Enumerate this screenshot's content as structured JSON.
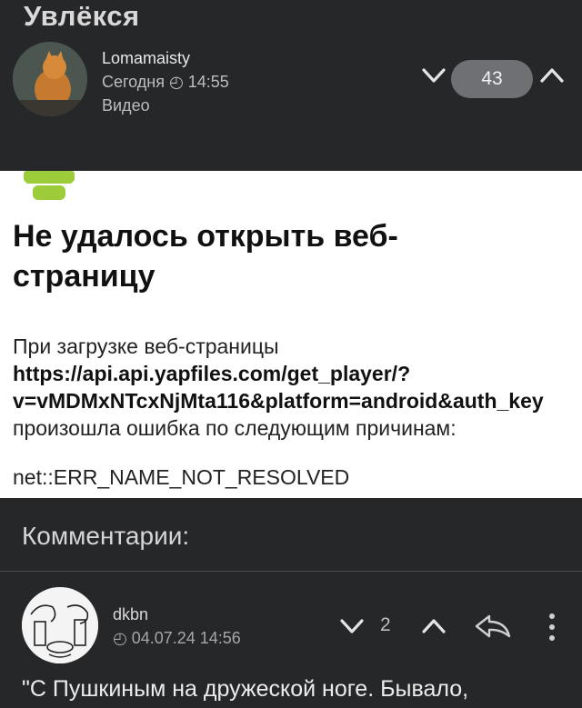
{
  "post": {
    "title": "Увлёкся",
    "author": "Lomamaisty",
    "date": "Сегодня ◴ 14:55",
    "type": "Видео",
    "rating": "43"
  },
  "webview_error": {
    "title": "Не удалось открыть веб-страницу",
    "line1": "При загрузке веб-страницы",
    "url_line1": "https://api.api.yapfiles.com/get_player/?",
    "url_line2": "v=vMDMxNTcxNjMta116&platform=android&auth_key",
    "line2": "произошла ошибка по следующим причинам:",
    "code": "net::ERR_NAME_NOT_RESOLVED"
  },
  "comments": {
    "header": "Комментарии:",
    "items": [
      {
        "author": "dkbn",
        "date": "◴ 04.07.24 14:56",
        "rating": "2",
        "text": "\"С Пушкиным на дружеской ноге. Бывало,"
      }
    ]
  },
  "icons": {
    "vote_down": "chevron-down-icon",
    "vote_up": "chevron-up-icon",
    "reply": "reply-icon",
    "more": "more-vertical-icon",
    "android": "android-robot-icon"
  },
  "colors": {
    "background": "#262729",
    "badge": "#6f7073",
    "android_green": "#9ccc3a",
    "webview_bg": "#ffffff"
  }
}
